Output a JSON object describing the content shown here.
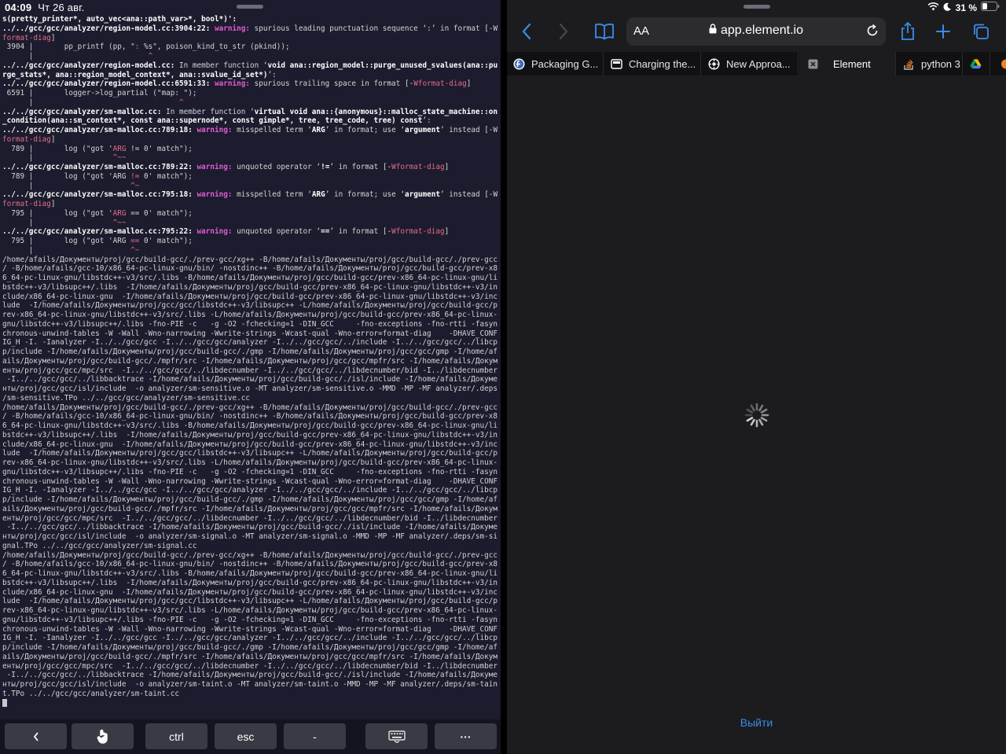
{
  "status_bar": {
    "time": "04:09",
    "date": "Чт 26 авг.",
    "battery": "31 %"
  },
  "terminal": {
    "lines": [
      [
        [
          "b",
          "s(pretty_printer*, auto_vec<ana::path_var>*, bool*)':"
        ]
      ],
      [
        [
          "b",
          "../../gcc/gcc/analyzer/region-model.cc:3904:22: "
        ],
        [
          "w",
          "warning: "
        ],
        [
          "t",
          "spurious leading punctuation sequence ‘:’ in format [-W"
        ]
      ],
      [
        [
          "m",
          "format-diag"
        ],
        [
          "t",
          "]"
        ]
      ],
      [
        [
          "t",
          " 3904 |       pp_printf (pp, \""
        ],
        [
          "m",
          ": "
        ],
        [
          "t",
          "%s\", poison_kind_to_str (pkind));"
        ]
      ],
      [
        [
          "t",
          "      |                          "
        ],
        [
          "m",
          "^"
        ]
      ],
      [
        [
          "b",
          "../../gcc/gcc/analyzer/region-model.cc:"
        ],
        [
          "t",
          " In member function ‘"
        ],
        [
          "b",
          "void ana::region_model::purge_unused_svalues(ana::pu"
        ]
      ],
      [
        [
          "b",
          "rge_stats*, ana::region_model_context*, ana::svalue_id_set*)"
        ],
        [
          "t",
          "’:"
        ]
      ],
      [
        [
          "b",
          "../../gcc/gcc/analyzer/region-model.cc:6591:33: "
        ],
        [
          "w",
          "warning: "
        ],
        [
          "t",
          "spurious trailing space in format [-"
        ],
        [
          "m",
          "Wformat-diag"
        ],
        [
          "t",
          "]"
        ]
      ],
      [
        [
          "t",
          " 6591 |       logger->log_partial (\"map: \");"
        ]
      ],
      [
        [
          "t",
          "      |                                 "
        ],
        [
          "m",
          "^"
        ]
      ],
      [
        [
          "b",
          "../../gcc/gcc/analyzer/sm-malloc.cc:"
        ],
        [
          "t",
          " In member function ‘"
        ],
        [
          "b",
          "virtual void ana::{anonymous}::malloc_state_machine::on"
        ]
      ],
      [
        [
          "b",
          "_condition(ana::sm_context*, const ana::supernode*, const gimple*, tree, tree_code, tree) const"
        ],
        [
          "t",
          "’:"
        ]
      ],
      [
        [
          "b",
          "../../gcc/gcc/analyzer/sm-malloc.cc:789:18: "
        ],
        [
          "w",
          "warning: "
        ],
        [
          "t",
          "misspelled term ‘"
        ],
        [
          "b",
          "ARG"
        ],
        [
          "t",
          "’ in format; use ‘"
        ],
        [
          "b",
          "argument"
        ],
        [
          "t",
          "’ instead [-W"
        ]
      ],
      [
        [
          "m",
          "format-diag"
        ],
        [
          "t",
          "]"
        ]
      ],
      [
        [
          "t",
          "  789 |       log (\"got '"
        ],
        [
          "m",
          "ARG"
        ],
        [
          "t",
          " != 0' match\");"
        ]
      ],
      [
        [
          "t",
          "      |                  "
        ],
        [
          "m",
          "^~~"
        ]
      ],
      [
        [
          "b",
          "../../gcc/gcc/analyzer/sm-malloc.cc:789:22: "
        ],
        [
          "w",
          "warning: "
        ],
        [
          "t",
          "unquoted operator ‘"
        ],
        [
          "b",
          "!="
        ],
        [
          "t",
          "’ in format [-"
        ],
        [
          "m",
          "Wformat-diag"
        ],
        [
          "t",
          "]"
        ]
      ],
      [
        [
          "t",
          "  789 |       log (\"got 'ARG "
        ],
        [
          "m",
          "!="
        ],
        [
          "t",
          " 0' match\");"
        ]
      ],
      [
        [
          "t",
          "      |                      "
        ],
        [
          "m",
          "^~"
        ]
      ],
      [
        [
          "b",
          "../../gcc/gcc/analyzer/sm-malloc.cc:795:18: "
        ],
        [
          "w",
          "warning: "
        ],
        [
          "t",
          "misspelled term ‘"
        ],
        [
          "b",
          "ARG"
        ],
        [
          "t",
          "’ in format; use ‘"
        ],
        [
          "b",
          "argument"
        ],
        [
          "t",
          "’ instead [-W"
        ]
      ],
      [
        [
          "m",
          "format-diag"
        ],
        [
          "t",
          "]"
        ]
      ],
      [
        [
          "t",
          "  795 |       log (\"got '"
        ],
        [
          "m",
          "ARG"
        ],
        [
          "t",
          " == 0' match\");"
        ]
      ],
      [
        [
          "t",
          "      |                  "
        ],
        [
          "m",
          "^~~"
        ]
      ],
      [
        [
          "b",
          "../../gcc/gcc/analyzer/sm-malloc.cc:795:22: "
        ],
        [
          "w",
          "warning: "
        ],
        [
          "t",
          "unquoted operator ‘"
        ],
        [
          "b",
          "=="
        ],
        [
          "t",
          "’ in format [-"
        ],
        [
          "m",
          "Wformat-diag"
        ],
        [
          "t",
          "]"
        ]
      ],
      [
        [
          "t",
          "  795 |       log (\"got 'ARG "
        ],
        [
          "m",
          "=="
        ],
        [
          "t",
          " 0' match\");"
        ]
      ],
      [
        [
          "t",
          "      |                      "
        ],
        [
          "m",
          "^~"
        ]
      ],
      [
        [
          "t",
          "/home/afails/Документы/proj/gcc/build-gcc/./prev-gcc/xg++ -B/home/afails/Документы/proj/gcc/build-gcc/./prev-gcc"
        ]
      ],
      [
        [
          "t",
          "/ -B/home/afails/gcc-10/x86_64-pc-linux-gnu/bin/ -nostdinc++ -B/home/afails/Документы/proj/gcc/build-gcc/prev-x8"
        ]
      ],
      [
        [
          "t",
          "6_64-pc-linux-gnu/libstdc++-v3/src/.libs -B/home/afails/Документы/proj/gcc/build-gcc/prev-x86_64-pc-linux-gnu/li"
        ]
      ],
      [
        [
          "t",
          "bstdc++-v3/libsupc++/.libs  -I/home/afails/Документы/proj/gcc/build-gcc/prev-x86_64-pc-linux-gnu/libstdc++-v3/in"
        ]
      ],
      [
        [
          "t",
          "clude/x86_64-pc-linux-gnu  -I/home/afails/Документы/proj/gcc/build-gcc/prev-x86_64-pc-linux-gnu/libstdc++-v3/inc"
        ]
      ],
      [
        [
          "t",
          "lude  -I/home/afails/Документы/proj/gcc/gcc/libstdc++-v3/libsupc++ -L/home/afails/Документы/proj/gcc/build-gcc/p"
        ]
      ],
      [
        [
          "t",
          "rev-x86_64-pc-linux-gnu/libstdc++-v3/src/.libs -L/home/afails/Документы/proj/gcc/build-gcc/prev-x86_64-pc-linux-"
        ]
      ],
      [
        [
          "t",
          "gnu/libstdc++-v3/libsupc++/.libs -fno-PIE -c   -g -O2 -fchecking=1 -DIN_GCC     -fno-exceptions -fno-rtti -fasyn"
        ]
      ],
      [
        [
          "t",
          "chronous-unwind-tables -W -Wall -Wno-narrowing -Wwrite-strings -Wcast-qual -Wno-error=format-diag    -DHAVE_CONF"
        ]
      ],
      [
        [
          "t",
          "IG_H -I. -Ianalyzer -I../../gcc/gcc -I../../gcc/gcc/analyzer -I../../gcc/gcc/../include -I../../gcc/gcc/../libcp"
        ]
      ],
      [
        [
          "t",
          "p/include -I/home/afails/Документы/proj/gcc/build-gcc/./gmp -I/home/afails/Документы/proj/gcc/gcc/gmp -I/home/af"
        ]
      ],
      [
        [
          "t",
          "ails/Документы/proj/gcc/build-gcc/./mpfr/src -I/home/afails/Документы/proj/gcc/gcc/mpfr/src -I/home/afails/Докум"
        ]
      ],
      [
        [
          "t",
          "енты/proj/gcc/gcc/mpc/src  -I../../gcc/gcc/../libdecnumber -I../../gcc/gcc/../libdecnumber/bid -I../libdecnumber"
        ]
      ],
      [
        [
          "t",
          " -I../../gcc/gcc/../libbacktrace -I/home/afails/Документы/proj/gcc/build-gcc/./isl/include -I/home/afails/Докуме"
        ]
      ],
      [
        [
          "t",
          "нты/proj/gcc/gcc/isl/include  -o analyzer/sm-sensitive.o -MT analyzer/sm-sensitive.o -MMD -MP -MF analyzer/.deps"
        ]
      ],
      [
        [
          "t",
          "/sm-sensitive.TPo ../../gcc/gcc/analyzer/sm-sensitive.cc"
        ]
      ],
      [
        [
          "t",
          "/home/afails/Документы/proj/gcc/build-gcc/./prev-gcc/xg++ -B/home/afails/Документы/proj/gcc/build-gcc/./prev-gcc"
        ]
      ],
      [
        [
          "t",
          "/ -B/home/afails/gcc-10/x86_64-pc-linux-gnu/bin/ -nostdinc++ -B/home/afails/Документы/proj/gcc/build-gcc/prev-x8"
        ]
      ],
      [
        [
          "t",
          "6_64-pc-linux-gnu/libstdc++-v3/src/.libs -B/home/afails/Документы/proj/gcc/build-gcc/prev-x86_64-pc-linux-gnu/li"
        ]
      ],
      [
        [
          "t",
          "bstdc++-v3/libsupc++/.libs  -I/home/afails/Документы/proj/gcc/build-gcc/prev-x86_64-pc-linux-gnu/libstdc++-v3/in"
        ]
      ],
      [
        [
          "t",
          "clude/x86_64-pc-linux-gnu  -I/home/afails/Документы/proj/gcc/build-gcc/prev-x86_64-pc-linux-gnu/libstdc++-v3/inc"
        ]
      ],
      [
        [
          "t",
          "lude  -I/home/afails/Документы/proj/gcc/gcc/libstdc++-v3/libsupc++ -L/home/afails/Документы/proj/gcc/build-gcc/p"
        ]
      ],
      [
        [
          "t",
          "rev-x86_64-pc-linux-gnu/libstdc++-v3/src/.libs -L/home/afails/Документы/proj/gcc/build-gcc/prev-x86_64-pc-linux-"
        ]
      ],
      [
        [
          "t",
          "gnu/libstdc++-v3/libsupc++/.libs -fno-PIE -c   -g -O2 -fchecking=1 -DIN_GCC     -fno-exceptions -fno-rtti -fasyn"
        ]
      ],
      [
        [
          "t",
          "chronous-unwind-tables -W -Wall -Wno-narrowing -Wwrite-strings -Wcast-qual -Wno-error=format-diag    -DHAVE_CONF"
        ]
      ],
      [
        [
          "t",
          "IG_H -I. -Ianalyzer -I../../gcc/gcc -I../../gcc/gcc/analyzer -I../../gcc/gcc/../include -I../../gcc/gcc/../libcp"
        ]
      ],
      [
        [
          "t",
          "p/include -I/home/afails/Документы/proj/gcc/build-gcc/./gmp -I/home/afails/Документы/proj/gcc/gcc/gmp -I/home/af"
        ]
      ],
      [
        [
          "t",
          "ails/Документы/proj/gcc/build-gcc/./mpfr/src -I/home/afails/Документы/proj/gcc/gcc/mpfr/src -I/home/afails/Докум"
        ]
      ],
      [
        [
          "t",
          "енты/proj/gcc/gcc/mpc/src  -I../../gcc/gcc/../libdecnumber -I../../gcc/gcc/../libdecnumber/bid -I../libdecnumber"
        ]
      ],
      [
        [
          "t",
          " -I../../gcc/gcc/../libbacktrace -I/home/afails/Документы/proj/gcc/build-gcc/./isl/include -I/home/afails/Докуме"
        ]
      ],
      [
        [
          "t",
          "нты/proj/gcc/gcc/isl/include  -o analyzer/sm-signal.o -MT analyzer/sm-signal.o -MMD -MP -MF analyzer/.deps/sm-si"
        ]
      ],
      [
        [
          "t",
          "gnal.TPo ../../gcc/gcc/analyzer/sm-signal.cc"
        ]
      ],
      [
        [
          "t",
          "/home/afails/Документы/proj/gcc/build-gcc/./prev-gcc/xg++ -B/home/afails/Документы/proj/gcc/build-gcc/./prev-gcc"
        ]
      ],
      [
        [
          "t",
          "/ -B/home/afails/gcc-10/x86_64-pc-linux-gnu/bin/ -nostdinc++ -B/home/afails/Документы/proj/gcc/build-gcc/prev-x8"
        ]
      ],
      [
        [
          "t",
          "6_64-pc-linux-gnu/libstdc++-v3/src/.libs -B/home/afails/Документы/proj/gcc/build-gcc/prev-x86_64-pc-linux-gnu/li"
        ]
      ],
      [
        [
          "t",
          "bstdc++-v3/libsupc++/.libs  -I/home/afails/Документы/proj/gcc/build-gcc/prev-x86_64-pc-linux-gnu/libstdc++-v3/in"
        ]
      ],
      [
        [
          "t",
          "clude/x86_64-pc-linux-gnu  -I/home/afails/Документы/proj/gcc/build-gcc/prev-x86_64-pc-linux-gnu/libstdc++-v3/inc"
        ]
      ],
      [
        [
          "t",
          "lude  -I/home/afails/Документы/proj/gcc/gcc/libstdc++-v3/libsupc++ -L/home/afails/Документы/proj/gcc/build-gcc/p"
        ]
      ],
      [
        [
          "t",
          "rev-x86_64-pc-linux-gnu/libstdc++-v3/src/.libs -L/home/afails/Документы/proj/gcc/build-gcc/prev-x86_64-pc-linux-"
        ]
      ],
      [
        [
          "t",
          "gnu/libstdc++-v3/libsupc++/.libs -fno-PIE -c   -g -O2 -fchecking=1 -DIN_GCC     -fno-exceptions -fno-rtti -fasyn"
        ]
      ],
      [
        [
          "t",
          "chronous-unwind-tables -W -Wall -Wno-narrowing -Wwrite-strings -Wcast-qual -Wno-error=format-diag    -DHAVE_CONF"
        ]
      ],
      [
        [
          "t",
          "IG_H -I. -Ianalyzer -I../../gcc/gcc -I../../gcc/gcc/analyzer -I../../gcc/gcc/../include -I../../gcc/gcc/../libcp"
        ]
      ],
      [
        [
          "t",
          "p/include -I/home/afails/Документы/proj/gcc/build-gcc/./gmp -I/home/afails/Документы/proj/gcc/gcc/gmp -I/home/af"
        ]
      ],
      [
        [
          "t",
          "ails/Документы/proj/gcc/build-gcc/./mpfr/src -I/home/afails/Документы/proj/gcc/gcc/mpfr/src -I/home/afails/Докум"
        ]
      ],
      [
        [
          "t",
          "енты/proj/gcc/gcc/mpc/src  -I../../gcc/gcc/../libdecnumber -I../../gcc/gcc/../libdecnumber/bid -I../libdecnumber"
        ]
      ],
      [
        [
          "t",
          " -I../../gcc/gcc/../libbacktrace -I/home/afails/Документы/proj/gcc/build-gcc/./isl/include -I/home/afails/Докуме"
        ]
      ],
      [
        [
          "t",
          "нты/proj/gcc/gcc/isl/include  -o analyzer/sm-taint.o -MT analyzer/sm-taint.o -MMD -MP -MF analyzer/.deps/sm-tain"
        ]
      ],
      [
        [
          "t",
          "t.TPo ../../gcc/gcc/analyzer/sm-taint.cc"
        ]
      ]
    ]
  },
  "key_bar": {
    "keys": [
      {
        "name": "arrow-left-key",
        "label": "<",
        "icon": "chevron-left"
      },
      {
        "name": "touch-key",
        "label": "",
        "icon": "hand-pointer-icon"
      },
      {
        "name": "ctrl-key",
        "label": "ctrl"
      },
      {
        "name": "esc-key",
        "label": "esc"
      },
      {
        "name": "dash-key",
        "label": "-"
      },
      {
        "name": "keyboard-key",
        "label": "",
        "icon": "keyboard-icon"
      },
      {
        "name": "more-key",
        "label": "···"
      }
    ]
  },
  "safari": {
    "aa_label": "AA",
    "url": "app.element.io",
    "tabs": [
      {
        "label": "Packaging G...",
        "icon": "fedora-icon",
        "active": false
      },
      {
        "label": "Charging the...",
        "icon": "page-icon",
        "active": false
      },
      {
        "label": "New Approa...",
        "icon": "gear-icon",
        "active": false
      },
      {
        "label": "Element",
        "icon": "close-icon",
        "active": true
      },
      {
        "label": "python 3",
        "icon": "stackoverflow-icon",
        "active": false
      },
      {
        "label": "",
        "icon": "drive-icon",
        "active": false
      }
    ],
    "logout_label": "Выйти"
  }
}
